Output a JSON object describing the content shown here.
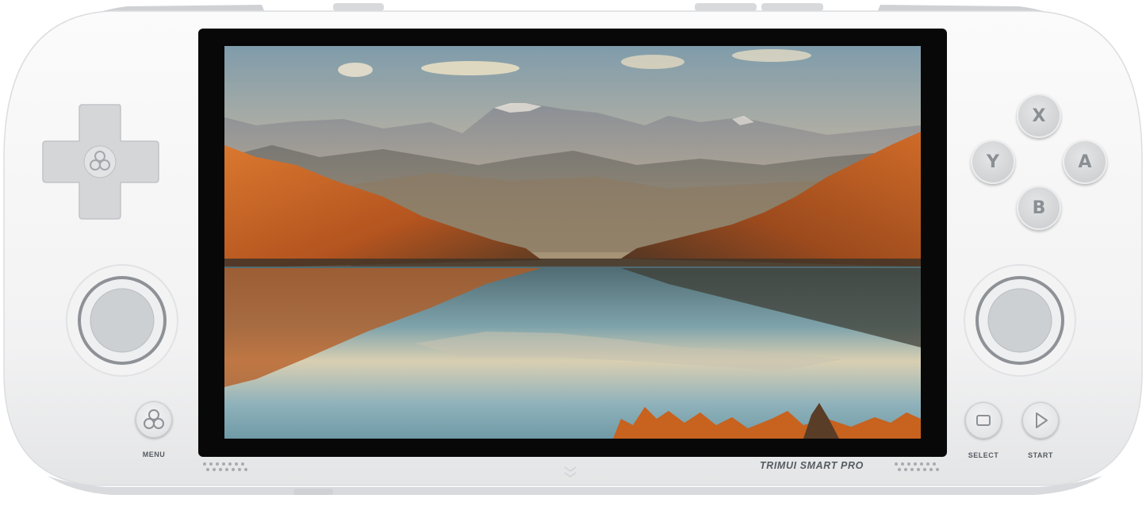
{
  "device": {
    "brand_label": "TRIMUI SMART PRO",
    "colors": {
      "body": "#f4f4f5",
      "accent_gray": "#d3d5d8",
      "label": "#555b61"
    }
  },
  "buttons": {
    "menu_label": "MENU",
    "select_label": "SELECT",
    "start_label": "START",
    "face": {
      "x": "X",
      "y": "Y",
      "a": "A",
      "b": "B"
    }
  },
  "screen": {
    "content": "mountain-lake-landscape-image"
  }
}
